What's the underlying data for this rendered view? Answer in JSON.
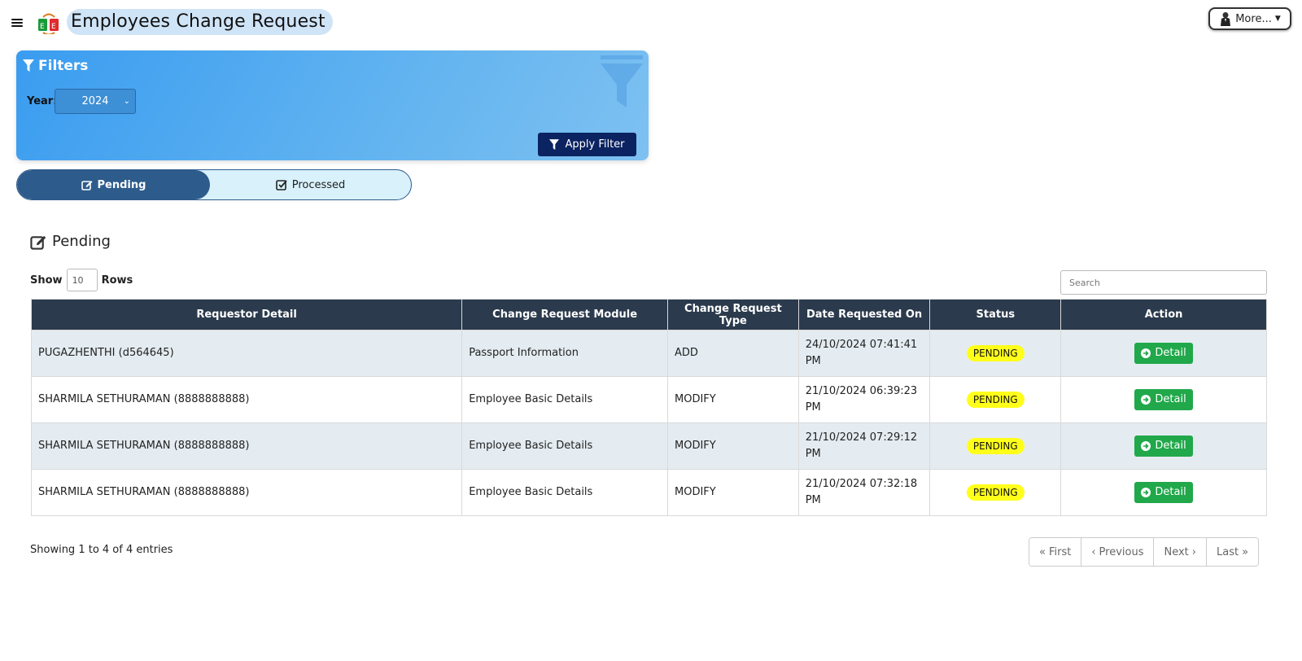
{
  "header": {
    "title": "Employees Change Request",
    "more_label": "More..."
  },
  "filters": {
    "title": "Filters",
    "year_label": "Year:",
    "year_value": "2024",
    "apply_label": "Apply Filter"
  },
  "tabs": [
    {
      "label": "Pending",
      "active": true
    },
    {
      "label": "Processed",
      "active": false
    }
  ],
  "section": {
    "title": "Pending"
  },
  "table_controls": {
    "show_label": "Show",
    "rows_value": "10",
    "rows_label": "Rows",
    "search_placeholder": "Search"
  },
  "table": {
    "columns": [
      "Requestor Detail",
      "Change Request Module",
      "Change Request Type",
      "Date Requested On",
      "Status",
      "Action"
    ],
    "rows": [
      {
        "requestor": "PUGAZHENTHI (d564645)",
        "module": "Passport Information",
        "type": "ADD",
        "date": "24/10/2024 07:41:41 PM",
        "status": "PENDING",
        "action": "Detail"
      },
      {
        "requestor": "SHARMILA SETHURAMAN (8888888888)",
        "module": "Employee Basic Details",
        "type": "MODIFY",
        "date": "21/10/2024 06:39:23 PM",
        "status": "PENDING",
        "action": "Detail"
      },
      {
        "requestor": "SHARMILA SETHURAMAN (8888888888)",
        "module": "Employee Basic Details",
        "type": "MODIFY",
        "date": "21/10/2024 07:29:12 PM",
        "status": "PENDING",
        "action": "Detail"
      },
      {
        "requestor": "SHARMILA SETHURAMAN (8888888888)",
        "module": "Employee Basic Details",
        "type": "MODIFY",
        "date": "21/10/2024 07:32:18 PM",
        "status": "PENDING",
        "action": "Detail"
      }
    ]
  },
  "footer": {
    "entries_info": "Showing 1 to 4 of 4 entries",
    "pager": {
      "first": "First",
      "previous": "Previous",
      "next": "Next",
      "last": "Last"
    }
  },
  "colors": {
    "header_bg": "#2b3a4c",
    "badge_pending": "#ffff1a",
    "detail_btn": "#20a84a",
    "apply_btn": "#0b2360",
    "tab_active": "#2d5b8c"
  }
}
